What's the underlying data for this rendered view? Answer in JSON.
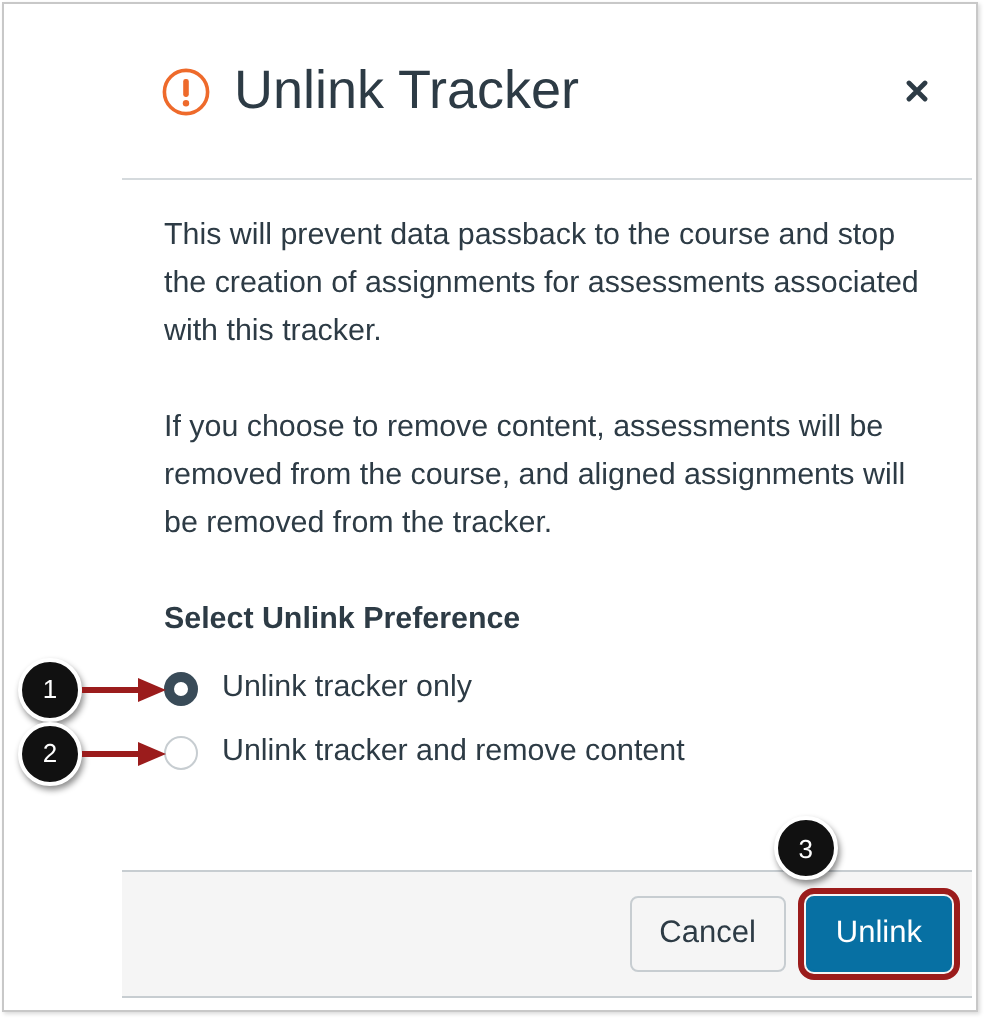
{
  "dialog": {
    "title": "Unlink Tracker",
    "paragraphs": [
      "This will prevent data passback to the course and stop the creation of assignments for assessments associated with this tracker.",
      "If you choose to remove content, assessments will be removed from the course, and aligned assignments will be removed from the tracker."
    ],
    "preference_label": "Select Unlink Preference",
    "options": [
      {
        "label": "Unlink tracker only",
        "selected": true,
        "callout": "1"
      },
      {
        "label": "Unlink tracker and remove content",
        "selected": false,
        "callout": "2"
      }
    ],
    "buttons": [
      {
        "label": "Cancel",
        "kind": "secondary",
        "highlighted": false
      },
      {
        "label": "Unlink",
        "kind": "primary",
        "highlighted": true,
        "callout": "3"
      }
    ]
  }
}
